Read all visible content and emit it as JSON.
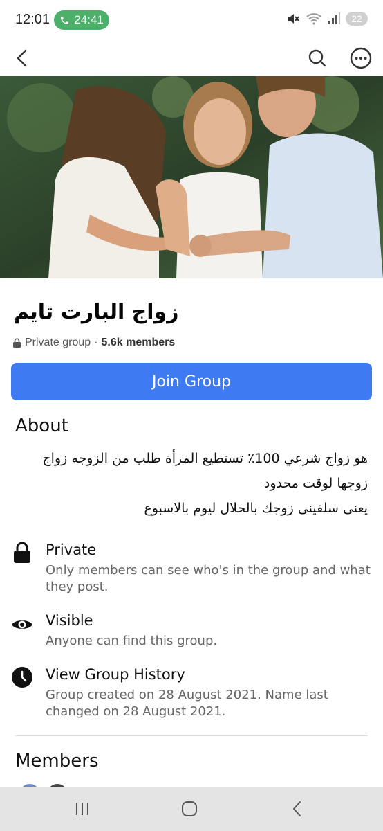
{
  "status_bar": {
    "time": "12:01",
    "call_timer": "24:41",
    "battery": "22",
    "icons": [
      "call-icon",
      "mute-icon",
      "wifi-icon",
      "signal-icon",
      "battery-icon"
    ]
  },
  "nav": {
    "icons": [
      "back-arrow-icon",
      "search-icon",
      "more-options-icon"
    ]
  },
  "group": {
    "name": "زواج البارت تايم",
    "privacy": "Private group",
    "separator": "·",
    "member_count": "5.6k members",
    "join_label": "Join Group",
    "accent": "#3e7bf3"
  },
  "about": {
    "title": "About",
    "lines": [
      "هو زواج شرعي 100٪  تستطيع المرأة طلب من الزوجه زواج",
      "زوجها لوقت محدود",
      "يعنى سلفينى زوجك بالحلال ليوم بالاسبوع"
    ]
  },
  "info": [
    {
      "icon": "lock-icon",
      "label": "Private",
      "description": "Only members can see who's in the group and what they post."
    },
    {
      "icon": "eye-icon",
      "label": "Visible",
      "description": "Anyone can find this group."
    },
    {
      "icon": "clock-icon",
      "label": "View Group History",
      "description": "Group created on 28 August 2021. Name last changed on 28 August 2021."
    }
  ],
  "members": {
    "title": "Members"
  },
  "android_nav": {
    "icons": [
      "recent-apps-icon",
      "home-icon",
      "back-icon"
    ]
  }
}
